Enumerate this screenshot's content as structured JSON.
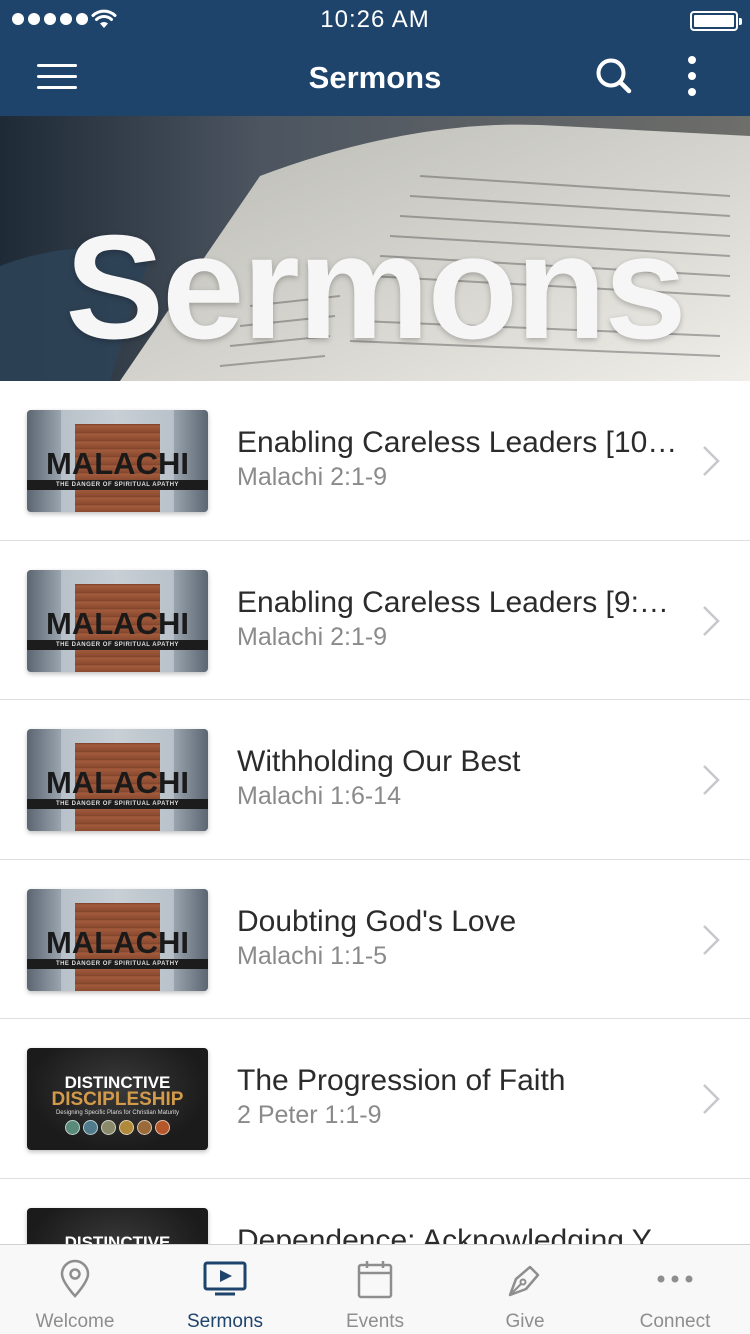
{
  "status_bar": {
    "time": "10:26 AM"
  },
  "nav": {
    "title": "Sermons"
  },
  "hero": {
    "title": "Sermons"
  },
  "sermons": [
    {
      "title": "Enabling Careless Leaders [10:...",
      "passage": "Malachi 2:1-9",
      "series": "malachi"
    },
    {
      "title": "Enabling Careless Leaders [9:0...",
      "passage": "Malachi 2:1-9",
      "series": "malachi"
    },
    {
      "title": "Withholding Our Best",
      "passage": "Malachi 1:6-14",
      "series": "malachi"
    },
    {
      "title": "Doubting God's Love",
      "passage": "Malachi 1:1-5",
      "series": "malachi"
    },
    {
      "title": "The Progression of Faith",
      "passage": "2 Peter 1:1-9",
      "series": "distinctive"
    },
    {
      "title": "Dependence: Acknowledging Y...",
      "passage": "",
      "series": "distinctive"
    }
  ],
  "thumbnails": {
    "malachi": {
      "word": "MALACHI",
      "tagline": "THE DANGER OF SPIRITUAL APATHY"
    },
    "distinctive": {
      "line1": "DISTINCTIVE",
      "line2": "DISCIPLESHIP",
      "tagline": "Designing Specific Plans for Christian Maturity"
    }
  },
  "tabs": [
    {
      "label": "Welcome",
      "icon": "map-pin-icon",
      "active": false
    },
    {
      "label": "Sermons",
      "icon": "video-icon",
      "active": true
    },
    {
      "label": "Events",
      "icon": "calendar-icon",
      "active": false
    },
    {
      "label": "Give",
      "icon": "pen-icon",
      "active": false
    },
    {
      "label": "Connect",
      "icon": "more-dots-icon",
      "active": false
    }
  ],
  "colors": {
    "brand": "#1f446c",
    "tab_inactive": "#8e8e8e",
    "subtitle": "#8a8a8a"
  }
}
